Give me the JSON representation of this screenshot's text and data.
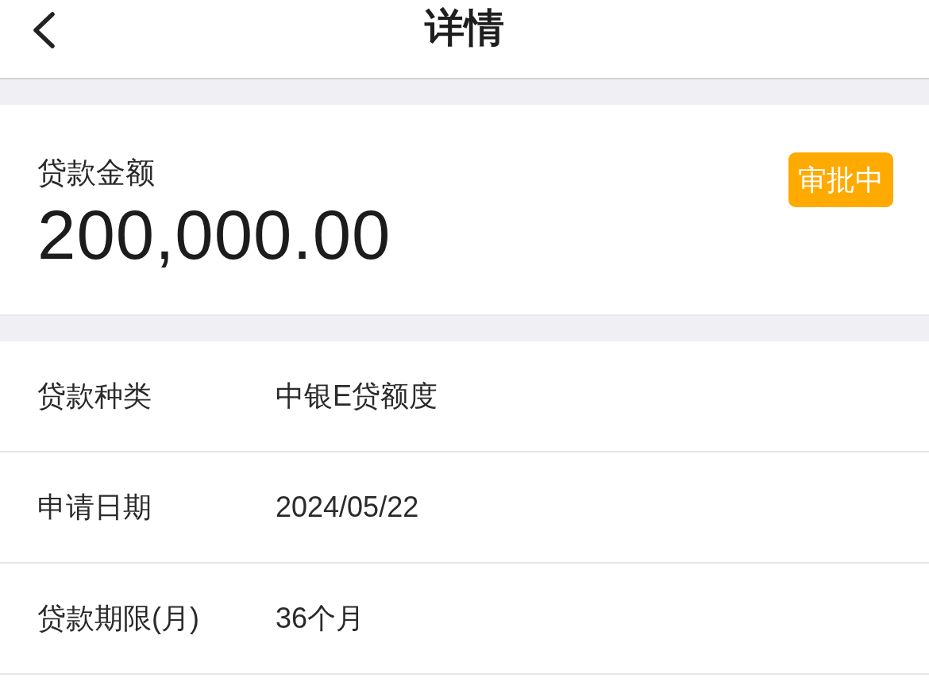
{
  "header": {
    "title": "详情"
  },
  "summary": {
    "label": "贷款金额",
    "amount": "200,000.00",
    "status": "审批中"
  },
  "details": [
    {
      "label": "贷款种类",
      "value": "中银E贷额度"
    },
    {
      "label": "申请日期",
      "value": "2024/05/22"
    },
    {
      "label": "贷款期限(月)",
      "value": "36个月"
    }
  ]
}
